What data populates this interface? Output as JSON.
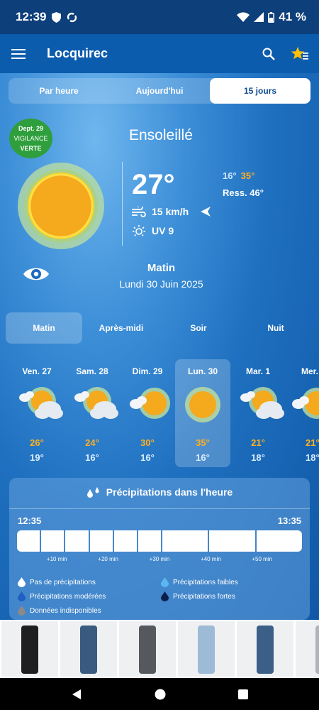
{
  "status": {
    "time": "12:39",
    "battery": "41 %"
  },
  "appbar": {
    "title": "Locquirec"
  },
  "tabs": [
    "Par heure",
    "Aujourd'hui",
    "15 jours"
  ],
  "vigilance": {
    "dept": "Dept. 29",
    "label": "VIGILANCE",
    "level": "VERTE",
    "color": "#2f9e3c"
  },
  "current": {
    "condition": "Ensoleillé",
    "temp": "27°",
    "wind": "15 km/h",
    "uv": "UV 9",
    "min": "16°",
    "max": "35°",
    "ress": "Ress. 46°"
  },
  "period": {
    "name": "Matin",
    "date": "Lundi 30 Juin 2025"
  },
  "segments": [
    "Matin",
    "Après-midi",
    "Soir",
    "Nuit"
  ],
  "days": [
    {
      "name": "Ven. 27",
      "hi": "26°",
      "lo": "19°",
      "icon": "sun-cloud-icon"
    },
    {
      "name": "Sam. 28",
      "hi": "24°",
      "lo": "16°",
      "icon": "sun-cloud-icon"
    },
    {
      "name": "Dim. 29",
      "hi": "30°",
      "lo": "16°",
      "icon": "sun-small-cloud-icon"
    },
    {
      "name": "Lun. 30",
      "hi": "35°",
      "lo": "16°",
      "icon": "sun-icon"
    },
    {
      "name": "Mar. 1",
      "hi": "21°",
      "lo": "18°",
      "icon": "sun-cloud-icon"
    },
    {
      "name": "Mer.",
      "hi": "21°",
      "lo": "18°",
      "icon": "sun-small-cloud-icon"
    }
  ],
  "precip": {
    "title": "Précipitations dans l'heure",
    "start": "12:35",
    "end": "13:35",
    "ticks": [
      "+10 min",
      "+20 min",
      "+30 min",
      "+40 min",
      "+50 min"
    ],
    "legend": {
      "none": "Pas de précipitations",
      "weak": "Précipitations faibles",
      "moderate": "Précipitations modérées",
      "strong": "Précipitations fortes",
      "unavailable": "Données indisponibles"
    }
  },
  "colors": {
    "accent_orange": "#ffb020",
    "brand_blue": "#0b5cad",
    "precip_none": "#ffffff",
    "precip_weak": "#5ab8f0",
    "precip_moderate": "#1f5fc2",
    "precip_strong": "#0b1f4a",
    "precip_unavailable": "#8a8a8a"
  }
}
